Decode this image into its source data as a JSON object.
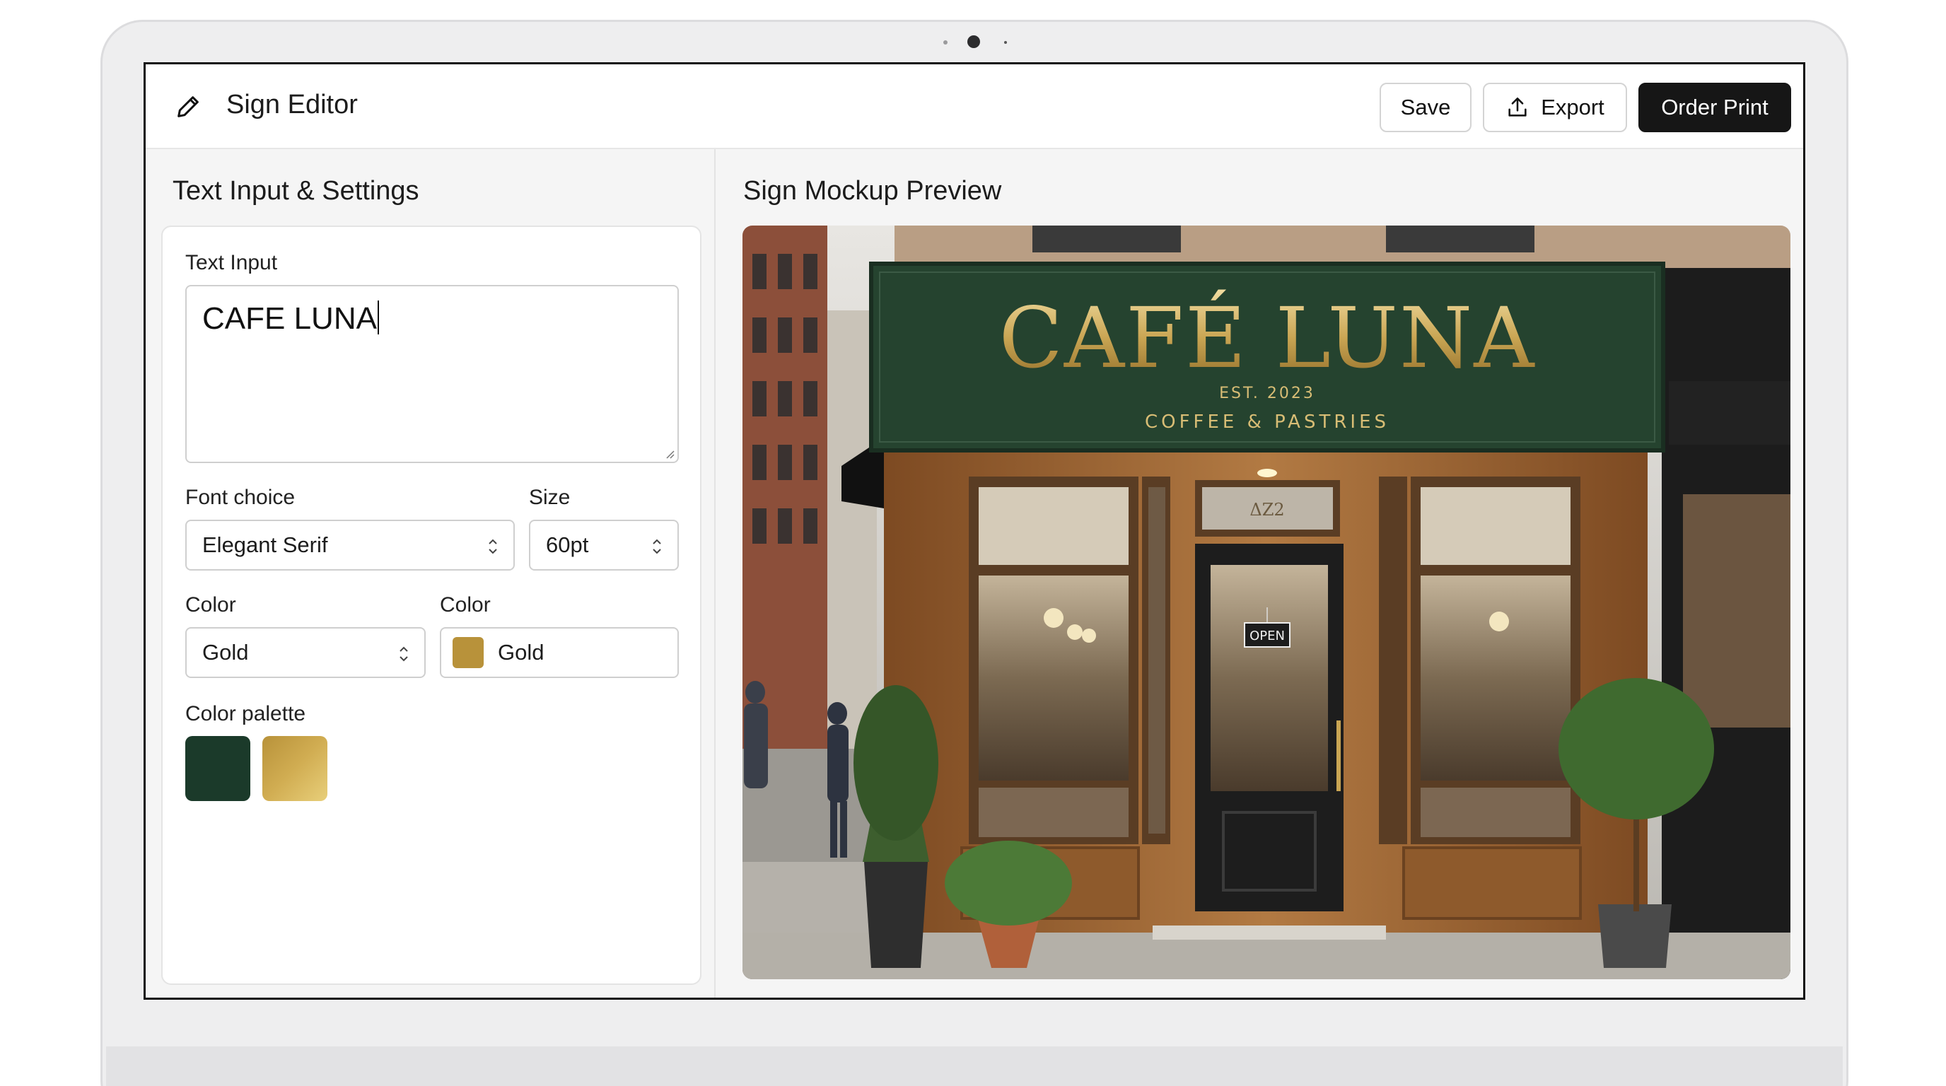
{
  "app": {
    "title": "Sign Editor"
  },
  "toolbar": {
    "save_label": "Save",
    "export_label": "Export",
    "order_label": "Order Print"
  },
  "left_panel": {
    "title": "Text Input & Settings",
    "text_input_label": "Text Input",
    "text_input_value": "CAFE LUNA",
    "font_label": "Font choice",
    "font_value": "Elegant Serif",
    "size_label": "Size",
    "size_value": "60pt",
    "color_label_1": "Color",
    "color_value_1": "Gold",
    "color_label_2": "Color",
    "color_value_2": "Gold",
    "palette_label": "Color palette",
    "palette": [
      "#1b3a2a",
      "#d1ad52"
    ]
  },
  "right_panel": {
    "title": "Sign Mockup Preview",
    "sign_main": "CAFÉ LUNA",
    "sign_est": "EST. 2023",
    "sign_sub": "COFFEE & PASTRIES",
    "transom_text": "ΔZ2",
    "door_sign": "OPEN"
  },
  "colors": {
    "sign_green": "#25432f",
    "gold": "#c9a553",
    "wood": "#9b6332",
    "door": "#1d1d1d"
  }
}
